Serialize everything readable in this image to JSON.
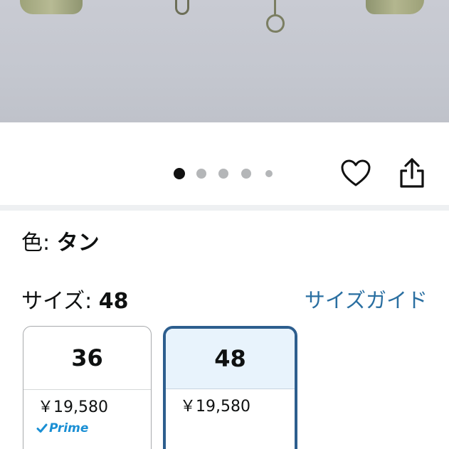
{
  "selection": {
    "color_label": "色:",
    "color_value": "タン",
    "size_label": "サイズ:",
    "size_value": "48",
    "size_guide_link": "サイズガイド"
  },
  "carousel": {
    "dots_total": 5,
    "active_index": 0
  },
  "actions": {
    "wishlist_icon": "heart-outline-icon",
    "share_icon": "share-icon"
  },
  "size_options": [
    {
      "size": "36",
      "price": "￥19,580",
      "prime": "Prime",
      "selected": false
    },
    {
      "size": "48",
      "price": "￥19,580",
      "prime": "",
      "selected": true
    }
  ],
  "colors": {
    "link": "#2a6fa1",
    "selected_border": "#2d5e8e",
    "selected_bg": "#e8f3fc",
    "prime": "#1a8fd4"
  }
}
